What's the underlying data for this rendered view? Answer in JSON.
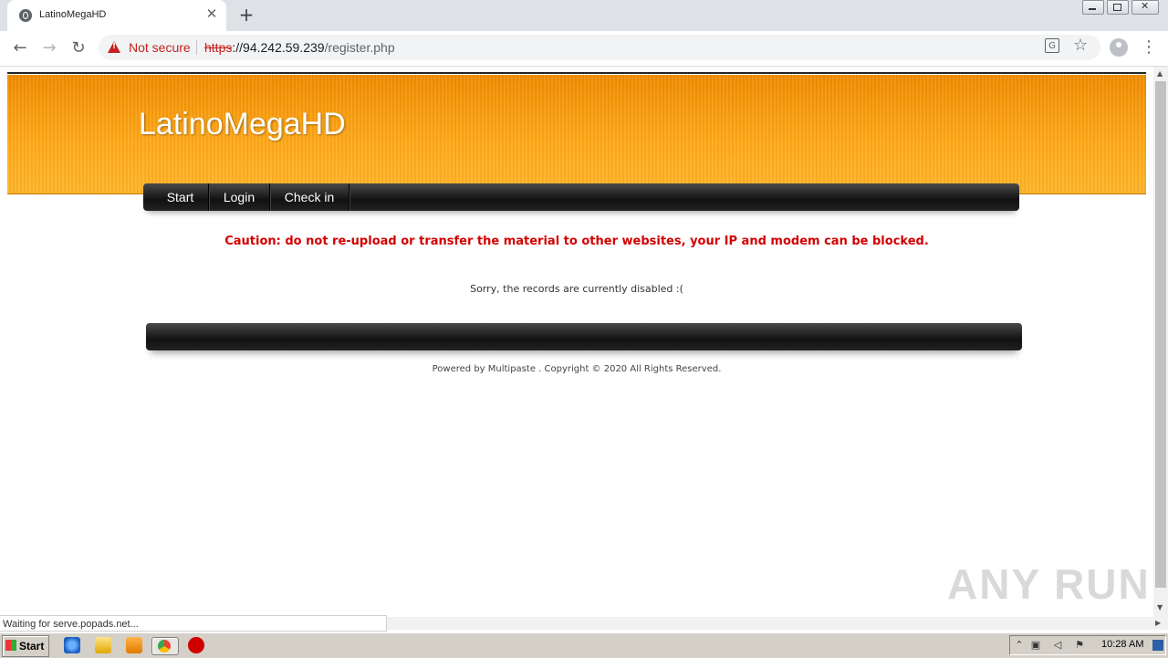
{
  "browser": {
    "tab_title": "LatinoMegaHD",
    "tab_close": "✕",
    "new_tab": "+",
    "security_label": "Not secure",
    "url_scheme": "https",
    "url_host": "://94.242.59.239",
    "url_path": "/register.php",
    "status_text": "Waiting for serve.popads.net..."
  },
  "site": {
    "title": "LatinoMegaHD",
    "nav": [
      "Start",
      "Login",
      "Check in"
    ],
    "caution": "Caution: do not re-upload or transfer the material to other websites, your IP and modem can be blocked.",
    "message": "Sorry, the records are currently disabled :(",
    "copyright": "Powered by Multipaste . Copyright © 2020 All Rights Reserved."
  },
  "watermark": "ANY RUN",
  "taskbar": {
    "start_label": "Start",
    "clock": "10:28 AM"
  },
  "colors": {
    "header_orange": "#ffa818",
    "caution_red": "#d40000",
    "not_secure_red": "#c5221f"
  }
}
